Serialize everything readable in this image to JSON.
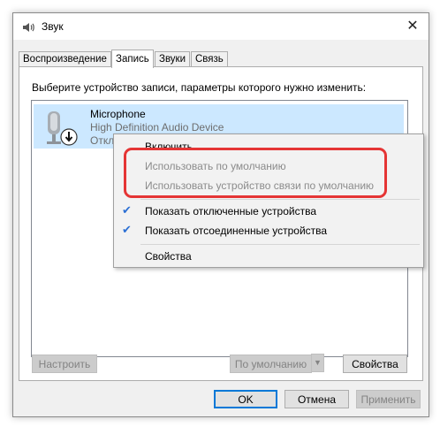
{
  "window": {
    "title": "Звук",
    "close_glyph": "✕"
  },
  "tabs": [
    {
      "label": "Воспроизведение",
      "active": false
    },
    {
      "label": "Запись",
      "active": true
    },
    {
      "label": "Звуки",
      "active": false
    },
    {
      "label": "Связь",
      "active": false
    }
  ],
  "panel": {
    "instruction": "Выберите устройство записи, параметры которого нужно изменить:",
    "device": {
      "name": "Microphone",
      "description": "High Definition Audio Device",
      "status": "Отключено",
      "icon": "microphone-icon"
    }
  },
  "context_menu": {
    "items": [
      {
        "label": "Включить",
        "enabled": true,
        "checked": false
      },
      {
        "label": "Использовать по умолчанию",
        "enabled": false,
        "checked": false
      },
      {
        "label": "Использовать устройство связи по умолчанию",
        "enabled": false,
        "checked": false
      },
      {
        "label": "Показать отключенные устройства",
        "enabled": true,
        "checked": true
      },
      {
        "label": "Показать отсоединенные устройства",
        "enabled": true,
        "checked": true
      },
      {
        "label": "Свойства",
        "enabled": true,
        "checked": false
      }
    ],
    "check_glyph": "✔"
  },
  "buttons": {
    "configure": "Настроить",
    "set_default": "По умолчанию",
    "properties": "Свойства",
    "ok": "OK",
    "cancel": "Отмена",
    "apply": "Применить"
  },
  "colors": {
    "selection": "#cce8ff",
    "highlight_border": "#e53535",
    "accent": "#0078d7"
  }
}
